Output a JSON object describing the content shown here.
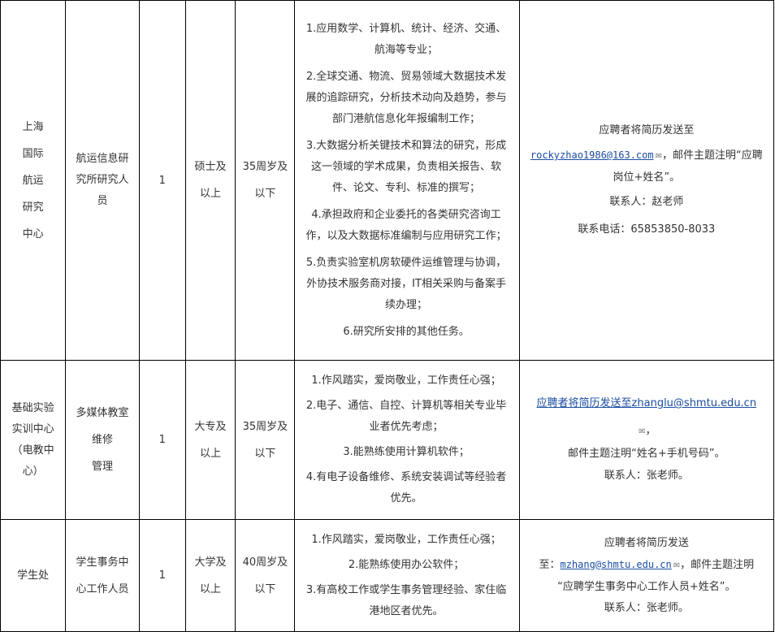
{
  "rows": [
    {
      "dept_lines": [
        "上海",
        "国际",
        "航运",
        "研究",
        "中心"
      ],
      "position_lines": [
        "航运信息研",
        "究所研究人",
        "员"
      ],
      "count": "1",
      "education_lines": [
        "硕士及",
        "以上"
      ],
      "age_lines": [
        "35周岁及",
        "以下"
      ],
      "duties": [
        "1.应用数学、计算机、统计、经济、交通、航海等专业；",
        "2.全球交通、物流、贸易领域大数据技术发展的追踪研究，分析技术动向及趋势，参与部门港航信息化年报编制工作；",
        "3.大数据分析关键技术和算法的研究，形成这一领域的学术成果，负责相关报告、软件、论文、专利、标准的撰写；",
        "4.承担政府和企业委托的各类研究咨询工作，以及大数据标准编制与应用研究工作；",
        "5.负责实验室机房软硬件运维管理与协调，外协技术服务商对接，IT相关采购与备案手续办理；",
        "6.研究所安排的其他任务。"
      ],
      "contact": {
        "line1": "应聘者将简历发送至",
        "email": "rockyzhao1986@163.com",
        "after_email": "，邮件主题注明“应聘岗位+姓名”。",
        "person": "联系人：赵老师",
        "phone": "联系电话：65853850-8033"
      }
    },
    {
      "dept_lines": [
        "基础实验",
        "实训中心",
        "（电教中",
        "心）"
      ],
      "position_lines": [
        "多媒体教室",
        "维修",
        "管理"
      ],
      "count": "1",
      "education_lines": [
        "大专及",
        "以上"
      ],
      "age_lines": [
        "35周岁及",
        "以下"
      ],
      "duties": [
        "1.作风踏实，爱岗敬业，工作责任心强；",
        "2.电子、通信、自控、计算机等相关专业毕业者优先考虑；",
        "3.能熟练使用计算机软件；",
        "4.有电子设备维修、系统安装调试等经验者优先。"
      ],
      "contact": {
        "line1_linked": "应聘者将简历发送至zhanglu@shmtu.edu.cn",
        "line1_tail": "，",
        "line2": "邮件主题注明“姓名+手机号码”。",
        "person": "联系人：张老师。"
      }
    },
    {
      "dept_lines": [
        "学生处"
      ],
      "position_lines": [
        "学生事务中",
        "心工作人员"
      ],
      "count": "1",
      "education_lines": [
        "大学及",
        "以上"
      ],
      "age_lines": [
        "40周岁及",
        "以下"
      ],
      "duties": [
        "1.作风踏实，爱岗敬业，工作责任心强；",
        "2.能熟练使用办公软件；",
        "3.有高校工作或学生事务管理经验、家住临港地区者优先。"
      ],
      "contact": {
        "line1": "应聘者将简历发送",
        "prefix": "至：",
        "email": "mzhang@shmtu.edu.cn",
        "after_email": "，邮件主题注明",
        "line3": "“应聘学生事务中心工作人员+姓名”。",
        "person": "联系人：张老师。"
      }
    }
  ],
  "icons": {
    "email": "envelope-icon"
  }
}
